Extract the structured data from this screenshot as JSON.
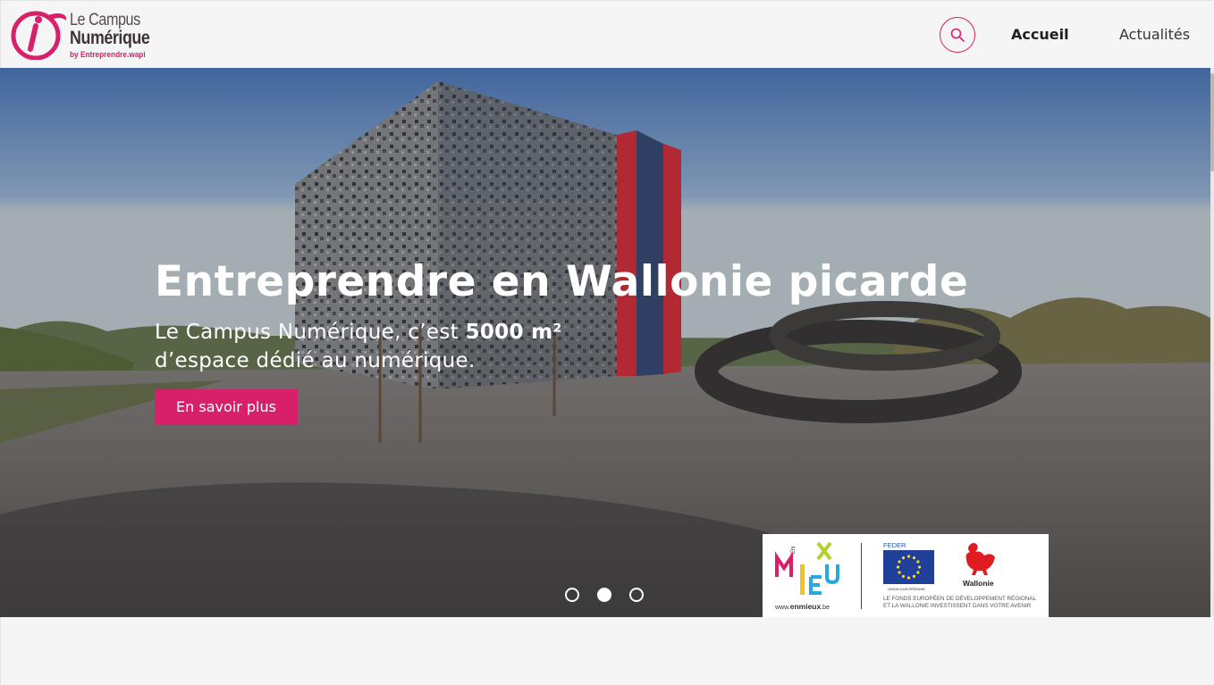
{
  "brand": {
    "logo_line1": "Le Campus",
    "logo_line2": "Numérique",
    "logo_line3": "by Entreprendre.wapi",
    "accent_color": "#d81f6a"
  },
  "nav": {
    "search_icon": "search-icon",
    "items": [
      {
        "label": "Accueil",
        "active": true
      },
      {
        "label": "Actualités",
        "active": false
      }
    ]
  },
  "hero": {
    "title": "Entreprendre en Wallonie picarde",
    "subtitle_pre": "Le Campus Numérique, c’est ",
    "subtitle_bold": "5000 m²",
    "subtitle_post": "d’espace dédié au numérique.",
    "cta_label": "En savoir plus"
  },
  "carousel": {
    "slide_count": 3,
    "active_index": 1
  },
  "funding": {
    "enmieux_url_prefix": "www.",
    "enmieux_url_bold": "enmieux",
    "enmieux_url_suffix": ".be",
    "feder_label": "FEDER",
    "ue_label": "UNION EUROPÉENNE",
    "wallonie_label": "Wallonie",
    "fonds_line1": "LE FONDS EUROPÉEN DE DÉVELOPPEMENT RÉGIONAL",
    "fonds_line2": "ET LA WALLONIE INVESTISSENT DANS VOTRE AVENIR"
  }
}
